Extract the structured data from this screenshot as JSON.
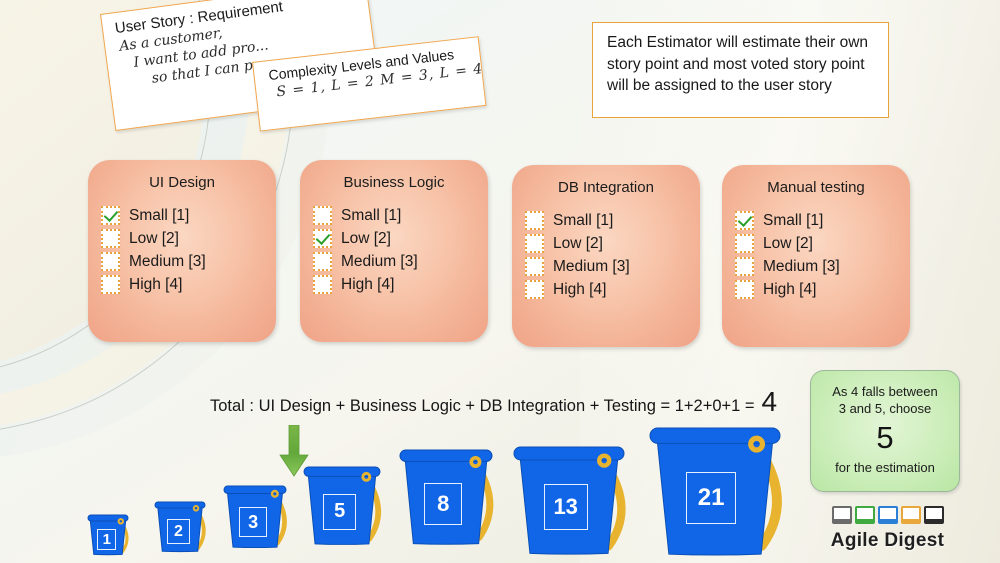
{
  "notes": {
    "user_story": {
      "title": "User Story : Requirement",
      "lines": [
        "As a customer,",
        "I want to add pro...",
        "so that I can p..."
      ]
    },
    "complexity": {
      "title": "Complexity Levels and Values",
      "lines": [
        "S = 1,  L = 2  M = 3,  L = 4"
      ]
    }
  },
  "callout": {
    "text": "Each Estimator will estimate their own story point and most voted story point will be assigned to the user story"
  },
  "estimators": [
    {
      "title": "UI Design",
      "options": [
        {
          "label": "Small [1]",
          "checked": true
        },
        {
          "label": "Low [2]",
          "checked": false
        },
        {
          "label": "Medium [3]",
          "checked": false
        },
        {
          "label": "High [4]",
          "checked": false
        }
      ]
    },
    {
      "title": "Business Logic",
      "options": [
        {
          "label": "Small [1]",
          "checked": false
        },
        {
          "label": "Low [2]",
          "checked": true
        },
        {
          "label": "Medium [3]",
          "checked": false
        },
        {
          "label": "High [4]",
          "checked": false
        }
      ]
    },
    {
      "title": "DB Integration",
      "options": [
        {
          "label": "Small [1]",
          "checked": false
        },
        {
          "label": "Low [2]",
          "checked": false
        },
        {
          "label": "Medium [3]",
          "checked": false
        },
        {
          "label": "High [4]",
          "checked": false
        }
      ]
    },
    {
      "title": "Manual testing",
      "options": [
        {
          "label": "Small [1]",
          "checked": true
        },
        {
          "label": "Low [2]",
          "checked": false
        },
        {
          "label": "Medium [3]",
          "checked": false
        },
        {
          "label": "High [4]",
          "checked": false
        }
      ]
    }
  ],
  "total": {
    "expression": "Total : UI Design + Business Logic + DB Integration + Testing = 1+2+0+1 =",
    "value": "4"
  },
  "result_box": {
    "line1": "As 4 falls between",
    "line2": "3 and 5, choose",
    "value": "5",
    "line3": "for the estimation"
  },
  "buckets": [
    {
      "label": "1"
    },
    {
      "label": "2"
    },
    {
      "label": "3"
    },
    {
      "label": "5"
    },
    {
      "label": "8"
    },
    {
      "label": "13"
    },
    {
      "label": "21"
    }
  ],
  "logo": {
    "brand": "Agile Digest",
    "frame_colors": [
      "#6b6b6b",
      "#3faa3f",
      "#2b7fd4",
      "#e8a83c",
      "#2b2b2b"
    ]
  },
  "colors": {
    "card_bg": "#f3b194",
    "checkbox_border": "#e8a33c",
    "check_green": "#2aa02a",
    "bucket_blue": "#1166e8",
    "bucket_handle": "#e8b430",
    "result_green": "#cdeebb",
    "note_border": "#f0a64e"
  }
}
